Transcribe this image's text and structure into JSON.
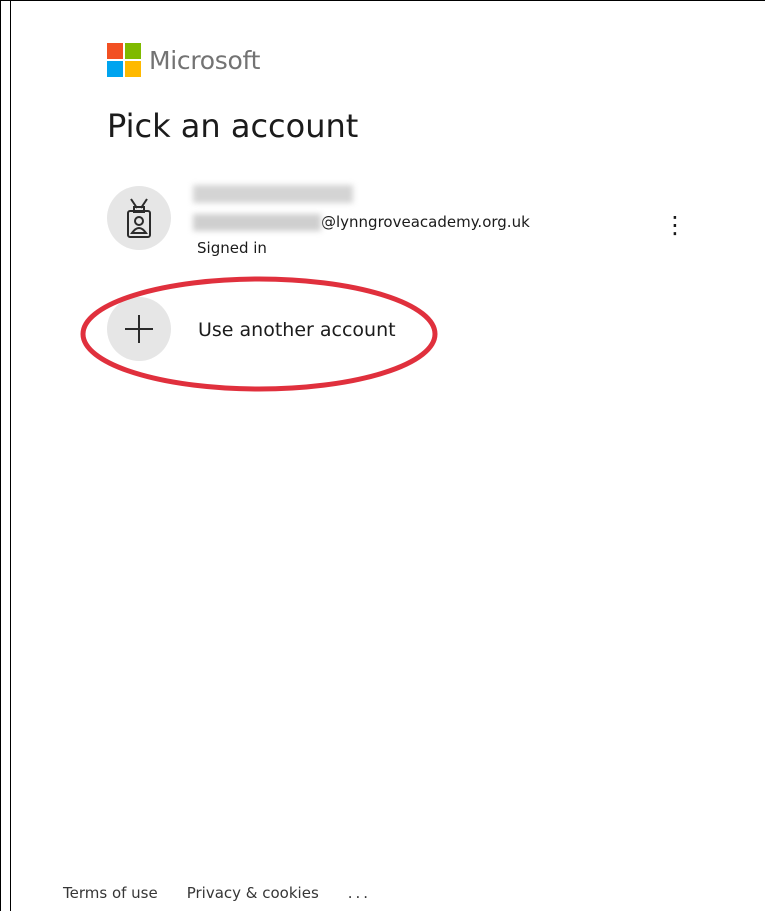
{
  "brand": {
    "name": "Microsoft",
    "colors": [
      "#f25022",
      "#7fba00",
      "#00a4ef",
      "#ffb900"
    ]
  },
  "page": {
    "title": "Pick an account"
  },
  "account": {
    "email_domain": "@lynngroveacademy.org.uk",
    "status": "Signed in",
    "more_icon": "vertical-ellipsis-icon",
    "more_label": "⋮"
  },
  "another_account": {
    "label": "Use another account",
    "icon": "plus-icon"
  },
  "annotation": {
    "highlight_color": "#e0303d"
  },
  "footer": {
    "terms": "Terms of use",
    "privacy": "Privacy & cookies",
    "more": "..."
  }
}
